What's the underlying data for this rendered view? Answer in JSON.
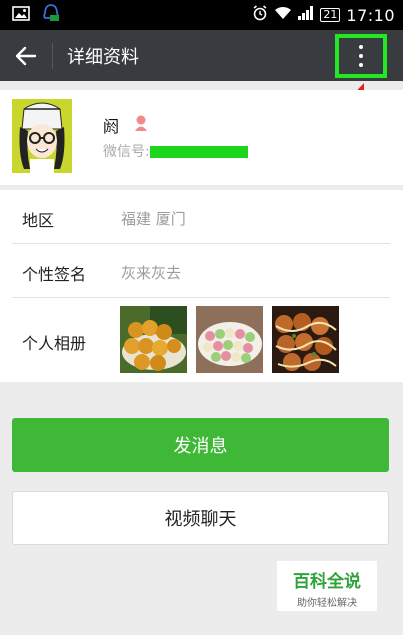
{
  "status_bar": {
    "clock": "17:10",
    "battery": "21"
  },
  "header": {
    "title": "详细资料"
  },
  "profile": {
    "name": "阏",
    "wechat_id_label": "微信号:"
  },
  "info": {
    "region_label": "地区",
    "region_value": "福建  厦门",
    "signature_label": "个性签名",
    "signature_value": "灰来灰去",
    "album_label": "个人相册"
  },
  "actions": {
    "send_message": "发消息",
    "video_chat": "视频聊天"
  },
  "watermark": {
    "title": "百科全说",
    "subtitle": "助你轻松解决"
  },
  "colors": {
    "action_bar": "#383b40",
    "primary_green": "#3fb837",
    "highlight_green": "#22e822",
    "arrow_red": "#e52020"
  }
}
